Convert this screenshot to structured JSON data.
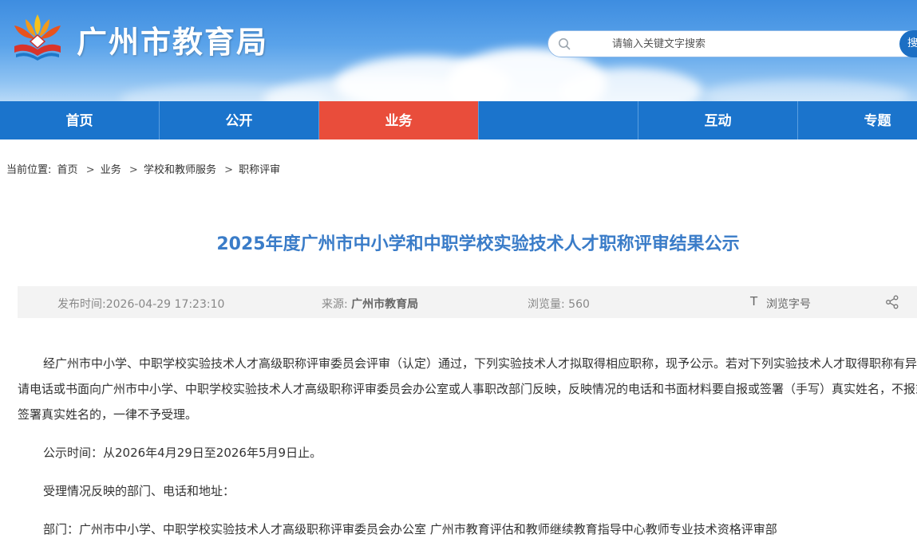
{
  "header": {
    "site_title": "广州市教育局",
    "search": {
      "placeholder": "请输入关键文字搜索",
      "button_label": "搜"
    }
  },
  "nav": {
    "items": [
      {
        "label": "首页"
      },
      {
        "label": "公开"
      },
      {
        "label": "业务"
      },
      {
        "label": ""
      },
      {
        "label": "互动"
      },
      {
        "label": "专题"
      }
    ],
    "active_index": 2,
    "colors": {
      "bar": "#1b74cc",
      "active": "#e94d3b"
    }
  },
  "breadcrumb": {
    "prefix": "当前位置:",
    "items": [
      "首页",
      "业务",
      "学校和教师服务",
      "职称评审"
    ],
    "separator": ">"
  },
  "article": {
    "title": "2025年度广州市中小学和中职学校实验技术人才职称评审结果公示",
    "meta": {
      "publish_label": "发布时间:",
      "publish_time": "2026-04-29 17:23:10",
      "source_label": "来源:",
      "source": "广州市教育局",
      "views_label": "浏览量:",
      "views": "560",
      "font_icon": "T",
      "font_label": "浏览字号"
    },
    "paragraphs": [
      "经广州市中小学、中职学校实验技术人才高级职称评审委员会评审（认定）通过，下列实验技术人才拟取得相应职称，现予公示。若对下列实验技术人才取得职称有异议，请电话或书面向广州市中小学、中职学校实验技术人才高级职称评审委员会办公室或人事职改部门反映，反映情况的电话和书面材料要自报或签署（手写）真实姓名，不报或不签署真实姓名的，一律不予受理。",
      "公示时间：从2026年4月29日至2026年5月9日止。",
      "受理情况反映的部门、电话和地址：",
      "部门：广州市中小学、中职学校实验技术人才高级职称评审委员会办公室  广州市教育评估和教师继续教育指导中心教师专业技术资格评审部"
    ],
    "colors": {
      "title": "#3a7cc8"
    }
  }
}
